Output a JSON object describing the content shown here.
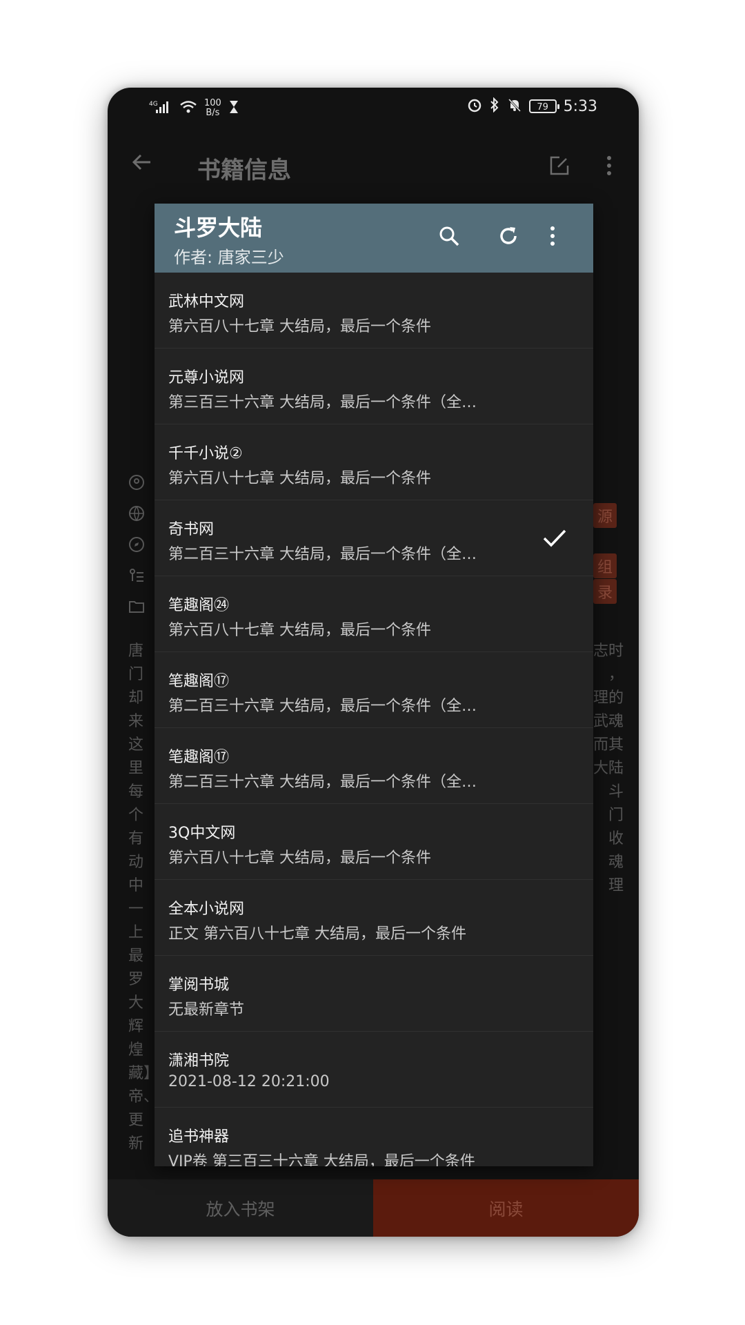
{
  "status_bar": {
    "signal": "4G",
    "net_speed_value": "100",
    "net_speed_unit": "B/s",
    "battery": "79",
    "time": "5:33",
    "icons": [
      "signal-icon",
      "wifi-icon",
      "hourglass-icon",
      "alarm-icon",
      "bluetooth-icon",
      "bell-off-icon",
      "battery-icon"
    ]
  },
  "app_bar": {
    "title": "书籍信息",
    "icons": [
      "back-arrow-icon",
      "edit-icon",
      "more-vert-icon"
    ]
  },
  "background": {
    "tags": [
      "源",
      "组",
      "录"
    ],
    "text_left": [
      "唐门",
      "却来",
      "这里",
      "每个",
      "有动",
      "中一",
      "上最",
      "罗大",
      "辉煌",
      "藏】",
      "帝、",
      "更新"
    ],
    "text_right": [
      "志时",
      "，",
      "理的",
      "武魂",
      "而其",
      "大陆",
      "斗",
      "门",
      "收",
      "魂",
      "理"
    ]
  },
  "dialog": {
    "title": "斗罗大陆",
    "subtitle": "作者: 唐家三少",
    "header_icons": [
      "search-icon",
      "refresh-icon",
      "more-vert-icon"
    ],
    "sources": [
      {
        "name": "武林中文网",
        "chapter": "第六百八十七章 大结局，最后一个条件",
        "selected": false
      },
      {
        "name": " 元尊小说网",
        "chapter": "第三百三十六章 大结局，最后一个条件（全…",
        "selected": false
      },
      {
        "name": "千千小说②",
        "chapter": "第六百八十七章 大结局，最后一个条件",
        "selected": false
      },
      {
        "name": "奇书网",
        "chapter": "第二百三十六章 大结局，最后一个条件（全…",
        "selected": true
      },
      {
        "name": "笔趣阁㉔",
        "chapter": "第六百八十七章 大结局，最后一个条件",
        "selected": false
      },
      {
        "name": "笔趣阁⑰",
        "chapter": "第二百三十六章 大结局，最后一个条件（全…",
        "selected": false
      },
      {
        "name": "笔趣阁⑰",
        "chapter": "第二百三十六章 大结局，最后一个条件（全…",
        "selected": false
      },
      {
        "name": "3Q中文网",
        "chapter": "第六百八十七章 大结局，最后一个条件",
        "selected": false
      },
      {
        "name": "全本小说网",
        "chapter": "正文 第六百八十七章 大结局，最后一个条件",
        "selected": false
      },
      {
        "name": "掌阅书城",
        "chapter": "无最新章节",
        "selected": false
      },
      {
        "name": "潇湘书院",
        "chapter": "2021-08-12 20:21:00",
        "selected": false
      },
      {
        "name": "追书神器",
        "chapter": "VIP卷 第三百三十六章 大结局，最后一个条件",
        "selected": false
      }
    ]
  },
  "bottom_bar": {
    "shelf_label": "放入书架",
    "read_label": "阅读"
  },
  "colors": {
    "dialog_header": "#546e7a",
    "dialog_bg": "#232323",
    "read_button": "#5b1b0d"
  }
}
